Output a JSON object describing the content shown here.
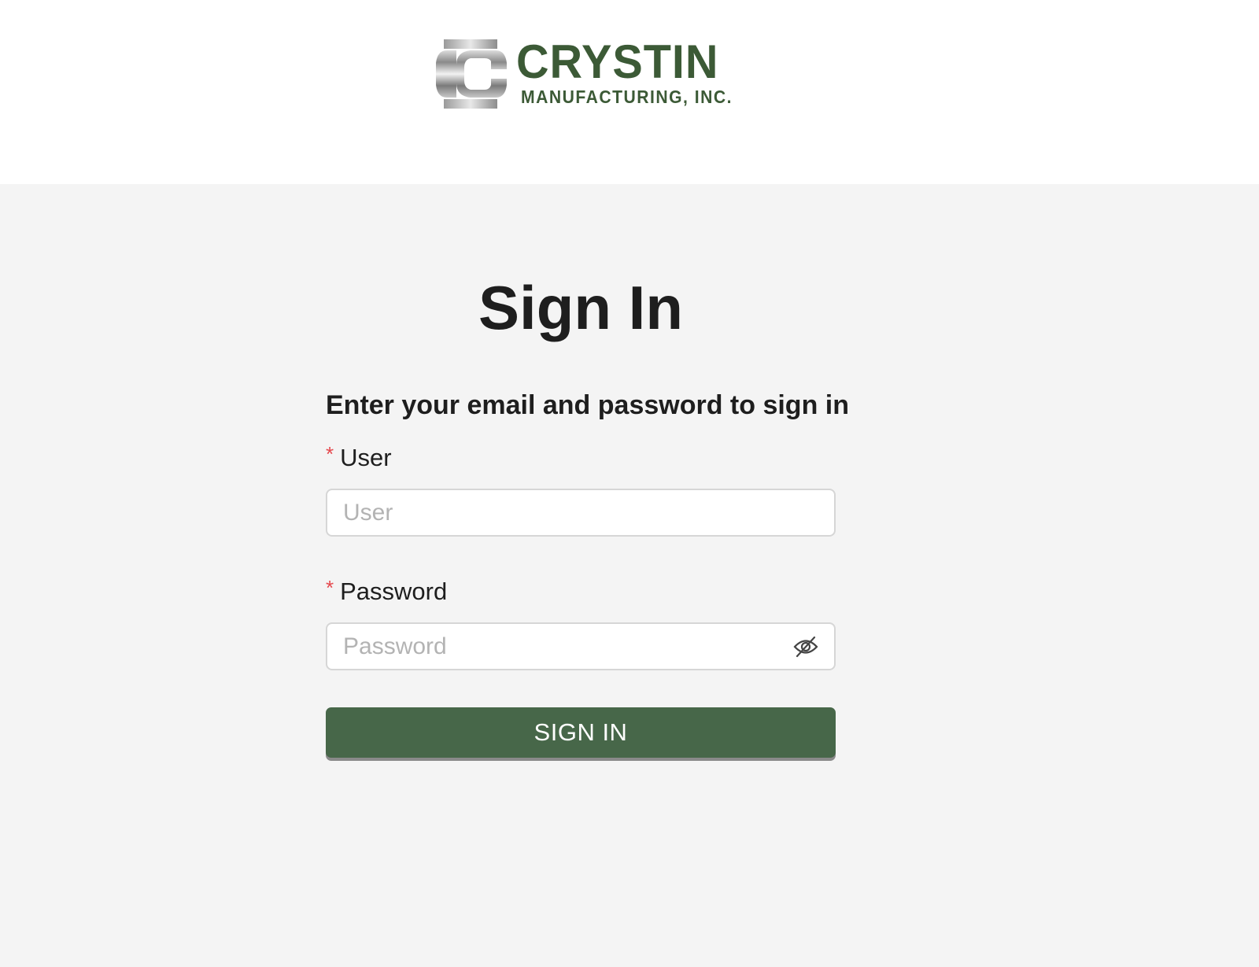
{
  "header": {
    "logo": {
      "name": "CRYSTIN",
      "subtitle": "MANUFACTURING, INC.",
      "brand_color": "#3c5a36"
    }
  },
  "form": {
    "title": "Sign In",
    "subtitle": "Enter your email and password to sign in",
    "required_marker": "*",
    "user": {
      "label": "User",
      "placeholder": "User",
      "value": ""
    },
    "password": {
      "label": "Password",
      "placeholder": "Password",
      "value": "",
      "toggle_icon": "eye-off-icon"
    },
    "submit_label": "SIGN IN",
    "button_color": "#476749"
  }
}
